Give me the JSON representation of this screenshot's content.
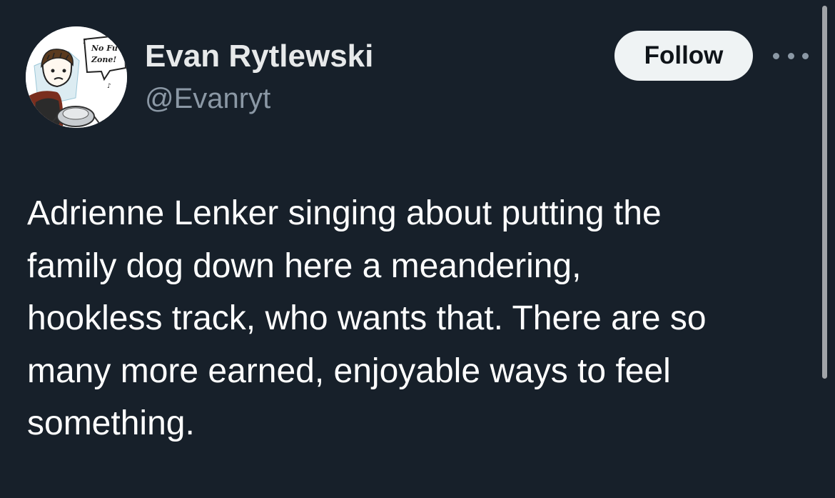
{
  "author": {
    "display_name": "Evan Rytlewski",
    "handle": "@Evanryt",
    "avatar": {
      "icon": "cartoon-avatar-icon",
      "speech_bubble_line1": "No Fu",
      "speech_bubble_line2": "Zone!"
    }
  },
  "actions": {
    "follow_label": "Follow",
    "more_icon": "more-options-icon"
  },
  "tweet": {
    "text_lines": [
      "Adrienne Lenker singing about putting the",
      "family dog down here a meandering,",
      "hookless track, who wants that. There are so",
      "many more earned, enjoyable ways to feel",
      "something."
    ]
  },
  "colors": {
    "background": "#17202a",
    "primary_text": "#e7e9ea",
    "secondary_text": "#8b98a5",
    "follow_bg": "#eff3f4",
    "follow_text": "#0f1419"
  }
}
